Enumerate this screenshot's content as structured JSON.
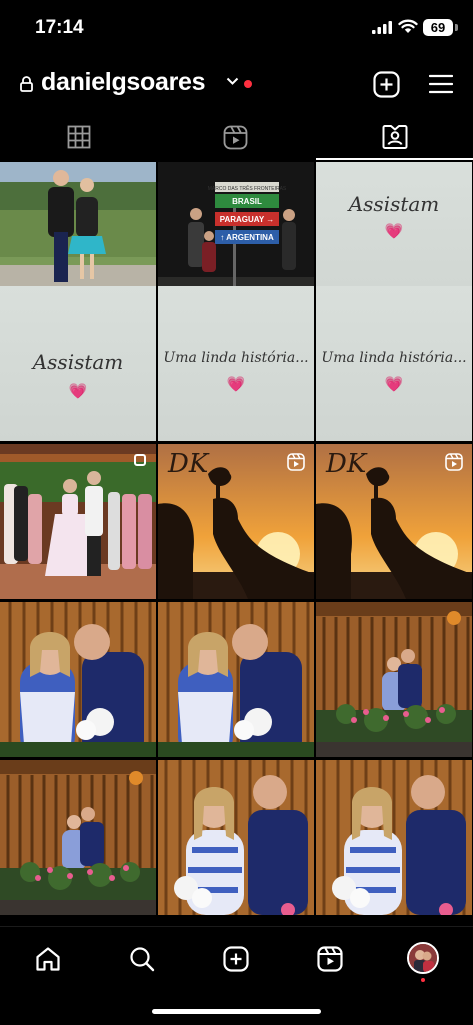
{
  "status_bar": {
    "time": "17:14",
    "battery": "69"
  },
  "profile": {
    "username": "danielgsoares",
    "notification_dot_color": "#ff3040"
  },
  "header": {
    "add_icon": "plus-square-icon",
    "menu_icon": "hamburger-menu-icon"
  },
  "tabs": [
    {
      "name": "grid",
      "icon": "grid-icon",
      "selected": false
    },
    {
      "name": "reels",
      "icon": "reels-icon",
      "selected": false
    },
    {
      "name": "tagged",
      "icon": "tagged-person-icon",
      "selected": true
    }
  ],
  "posts": [
    {
      "type": "photo",
      "scene": "couple-outdoor"
    },
    {
      "type": "photo",
      "scene": "border-signs",
      "signs": [
        "MARCO DAS TRÊS FRONTEIRAS",
        "BRASIL",
        "PARAGUAY",
        "ARGENTINA"
      ]
    },
    {
      "type": "text",
      "text": "Assistam",
      "heart": "💗"
    },
    {
      "type": "text",
      "text": "Assistam",
      "heart": "💗"
    },
    {
      "type": "text",
      "text": "Uma linda história...",
      "heart": "💗"
    },
    {
      "type": "text",
      "text": "Uma linda história...",
      "heart": "💗"
    },
    {
      "type": "photo",
      "scene": "wedding-group",
      "badge": "carousel"
    },
    {
      "type": "photo",
      "scene": "sunset-silhouette",
      "badge": "reel",
      "sign": "DK"
    },
    {
      "type": "photo",
      "scene": "sunset-silhouette",
      "badge": "reel",
      "sign": "DK"
    },
    {
      "type": "photo",
      "scene": "couple-kiss-bamboo"
    },
    {
      "type": "photo",
      "scene": "couple-kiss-bamboo"
    },
    {
      "type": "photo",
      "scene": "couple-bamboo-wide"
    },
    {
      "type": "photo",
      "scene": "couple-bamboo-wide"
    },
    {
      "type": "photo",
      "scene": "couple-bamboo-closeup"
    },
    {
      "type": "photo",
      "scene": "couple-bamboo-closeup"
    }
  ],
  "bottom_nav": [
    "home-icon",
    "search-icon",
    "create-icon",
    "reels-icon",
    "profile-avatar"
  ]
}
